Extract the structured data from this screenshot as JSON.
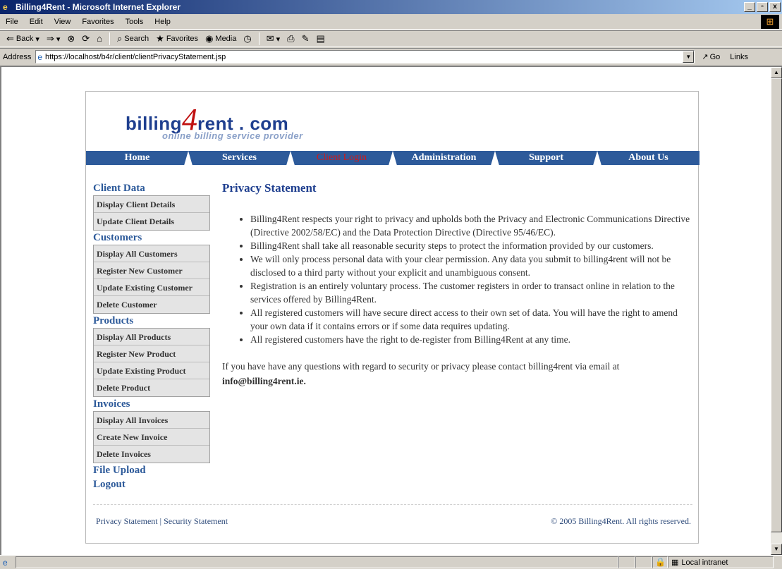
{
  "window": {
    "title": "Billing4Rent - Microsoft Internet Explorer",
    "min": "_",
    "max": "▫",
    "close": "x"
  },
  "menu": [
    "File",
    "Edit",
    "View",
    "Favorites",
    "Tools",
    "Help"
  ],
  "toolbar": {
    "back": "Back",
    "search": "Search",
    "favorites": "Favorites",
    "media": "Media"
  },
  "address": {
    "label": "Address",
    "url": "https://localhost/b4r/client/clientPrivacyStatement.jsp",
    "go": "Go",
    "links": "Links"
  },
  "site": {
    "brand_left": "billing",
    "brand_four": "4",
    "brand_right": "rent . com",
    "tagline": "online billing service provider"
  },
  "nav": {
    "home": "Home",
    "services": "Services",
    "client_login": "Client Login",
    "administration": "Administration",
    "support": "Support",
    "about": "About Us"
  },
  "sidebar": {
    "client_data": {
      "title": "Client Data",
      "items": [
        "Display Client Details",
        "Update Client Details"
      ]
    },
    "customers": {
      "title": "Customers",
      "items": [
        "Display All Customers",
        "Register New Customer",
        "Update Existing Customer",
        "Delete Customer"
      ]
    },
    "products": {
      "title": "Products",
      "items": [
        "Display All Products",
        "Register New Product",
        "Update Existing Product",
        "Delete Product"
      ]
    },
    "invoices": {
      "title": "Invoices",
      "items": [
        "Display All Invoices",
        "Create New Invoice",
        "Delete Invoices"
      ]
    },
    "file_upload": "File Upload",
    "logout": "Logout"
  },
  "content": {
    "heading": "Privacy Statement",
    "bullets": [
      "Billing4Rent respects your right to privacy and upholds both the Privacy and Electronic Communications Directive (Directive 2002/58/EC) and the Data Protection Directive (Directive 95/46/EC).",
      "Billing4Rent shall take all reasonable security steps to protect the information provided by our customers.",
      "We will only process personal data with your clear permission. Any data you submit to billing4rent will not be disclosed to a third party without your explicit and unambiguous consent.",
      "Registration is an entirely voluntary process. The customer registers in order to transact online in relation to the services offered by Billing4Rent.",
      "All registered customers will have secure direct access to their own set of data. You will have the right to amend your own data if it contains errors or if some data requires updating.",
      "All registered customers have the right to de-register from Billing4Rent at any time."
    ],
    "contact_text": "If you have have any questions with regard to security or privacy please contact billing4rent via email at ",
    "contact_email": "info@billing4rent.ie."
  },
  "footer": {
    "privacy": "Privacy Statement",
    "sep": " | ",
    "security": "Security Statement",
    "copyright": "© 2005 Billing4Rent. All rights reserved."
  },
  "status": {
    "zone": "Local intranet"
  },
  "colors": {
    "nav_blue": "#2d5a9a",
    "active_red": "#d01818",
    "title_bar": "#0a246a"
  }
}
